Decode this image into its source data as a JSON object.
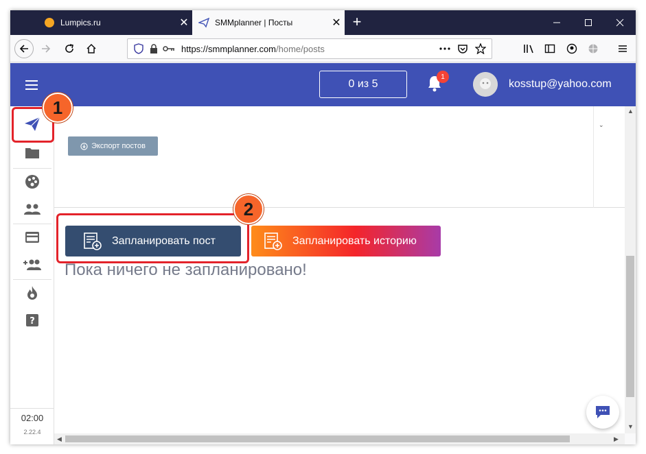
{
  "browser": {
    "tabs": [
      {
        "title": "Lumpics.ru",
        "favicon": "lumpics-favicon",
        "active": false
      },
      {
        "title": "SMMplanner | Посты",
        "favicon": "smmplanner-favicon",
        "active": true
      }
    ],
    "url_host": "https://smmplanner.com",
    "url_path": "/home/posts"
  },
  "header": {
    "counter": "0 из 5",
    "notification_count": "1",
    "email": "kosstup@yahoo.com",
    "color": "#3f51b5"
  },
  "sidebar": {
    "items": [
      {
        "name": "posts",
        "icon": "paper-plane-icon",
        "active": true
      },
      {
        "name": "folders",
        "icon": "folder-icon"
      },
      {
        "name": "social",
        "icon": "palette-icon"
      },
      {
        "name": "accounts",
        "icon": "people-icon"
      },
      {
        "name": "billing",
        "icon": "credit-card-icon"
      },
      {
        "name": "invite",
        "icon": "add-people-icon"
      },
      {
        "name": "promo",
        "icon": "fire-icon"
      },
      {
        "name": "help",
        "icon": "help-icon"
      }
    ],
    "time": "02:00",
    "version": "2.22.4"
  },
  "main": {
    "export_label": "Экспорт постов",
    "schedule_post_label": "Запланировать пост",
    "schedule_story_label": "Запланировать историю",
    "empty_message": "Пока ничего не запланировано!"
  },
  "annotations": {
    "marker_1": "1",
    "marker_2": "2",
    "highlight_color": "#e3232a",
    "marker_color": "#f6652a"
  }
}
